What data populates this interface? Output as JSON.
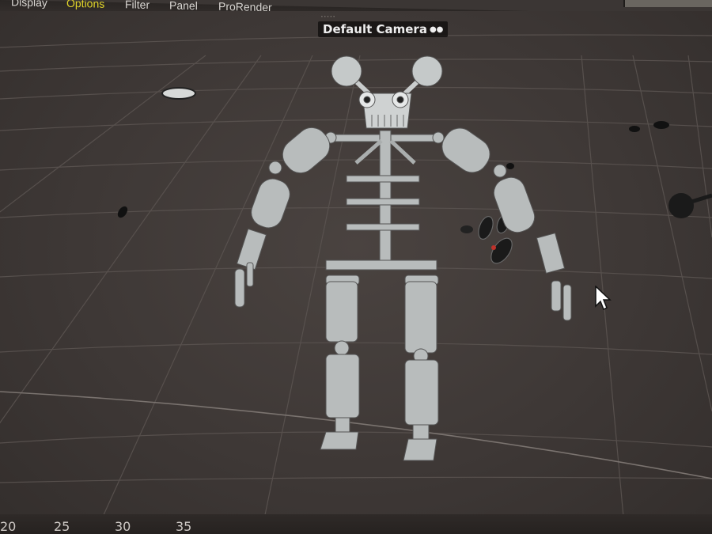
{
  "menubar": {
    "items": [
      {
        "label": "Display",
        "active": false
      },
      {
        "label": "Options",
        "active": true
      },
      {
        "label": "Filter",
        "active": false
      },
      {
        "label": "Panel",
        "active": false
      },
      {
        "label": "ProRender",
        "active": false
      }
    ]
  },
  "viewport": {
    "camera_label": "Default Camera",
    "camera_icon": "camera-dots-icon",
    "object": "skeleton-rig-model",
    "colors": {
      "background": "#3e3836",
      "grid": "#5a5350",
      "model": "#b8bcbc"
    }
  },
  "timeline": {
    "ticks": [
      "20",
      "25",
      "30",
      "35"
    ]
  }
}
